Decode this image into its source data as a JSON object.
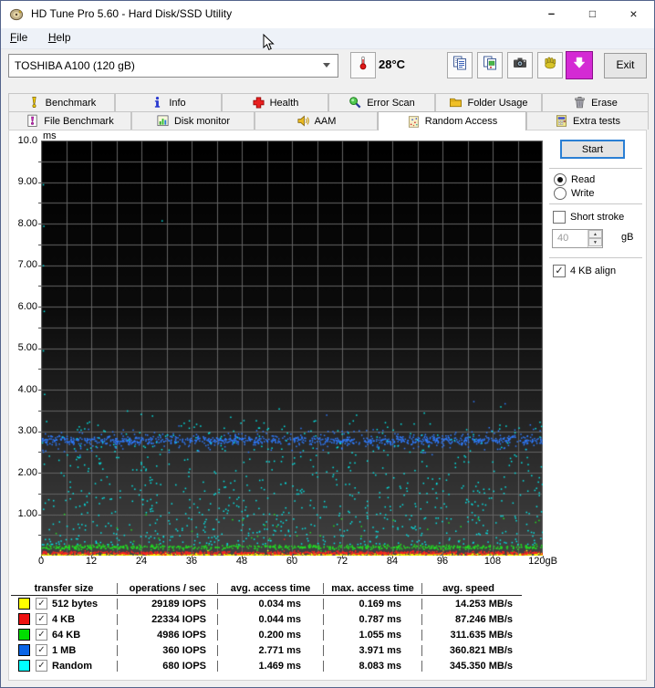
{
  "window": {
    "title": "HD Tune Pro 5.60 - Hard Disk/SSD Utility"
  },
  "icons": {
    "minimize_glyph": "–",
    "maximize_glyph": "□",
    "close_glyph": "×",
    "checkmark_glyph": "✓",
    "spin_up_glyph": "▲",
    "spin_down_glyph": "▼"
  },
  "menu": {
    "items": [
      {
        "label": "File"
      },
      {
        "label": "Help"
      }
    ]
  },
  "toolbar": {
    "drive_selector_value": "TOSHIBA A100 (120 gB)",
    "temperature": "28°C",
    "buttons": [
      {
        "icon": "thermometer-icon"
      },
      {
        "icon": "copy-text-icon"
      },
      {
        "icon": "copy-image-icon"
      },
      {
        "icon": "camera-icon"
      },
      {
        "icon": "donate-hand-icon"
      },
      {
        "icon": "download-icon"
      }
    ],
    "exit_label": "Exit"
  },
  "tabs": {
    "row1": [
      {
        "label": "Benchmark",
        "icon": "benchmark-icon"
      },
      {
        "label": "Info",
        "icon": "info-icon"
      },
      {
        "label": "Health",
        "icon": "health-icon"
      },
      {
        "label": "Error Scan",
        "icon": "error-scan-icon"
      },
      {
        "label": "Folder Usage",
        "icon": "folder-icon"
      },
      {
        "label": "Erase",
        "icon": "erase-icon"
      }
    ],
    "row2": [
      {
        "label": "File Benchmark",
        "icon": "file-benchmark-icon"
      },
      {
        "label": "Disk monitor",
        "icon": "disk-monitor-icon"
      },
      {
        "label": "AAM",
        "icon": "aam-icon"
      },
      {
        "label": "Random Access",
        "icon": "random-access-icon",
        "active": true
      },
      {
        "label": "Extra tests",
        "icon": "extra-tests-icon"
      }
    ],
    "active_tab": "Random Access"
  },
  "side_panel": {
    "start_label": "Start",
    "mode_options": [
      {
        "label": "Read",
        "selected": true
      },
      {
        "label": "Write",
        "selected": false
      }
    ],
    "short_stroke_label": "Short stroke",
    "short_stroke_checked": false,
    "short_stroke_value": "40",
    "short_stroke_unit": "gB",
    "align_label": "4 KB align",
    "align_checked": true
  },
  "chart_data": {
    "type": "scatter",
    "title": "Random Access access-time vs disk position",
    "ylabel_unit": "ms",
    "xlabel_unit": "gB",
    "ylim": [
      0,
      10
    ],
    "xlim": [
      0,
      120
    ],
    "grid": {
      "on": true,
      "x_step": 6,
      "y_step": 0.5
    },
    "y_ticks": [
      {
        "v": 10,
        "label": "10.0"
      },
      {
        "v": 9,
        "label": "9.00"
      },
      {
        "v": 8,
        "label": "8.00"
      },
      {
        "v": 7,
        "label": "7.00"
      },
      {
        "v": 6,
        "label": "6.00"
      },
      {
        "v": 5,
        "label": "5.00"
      },
      {
        "v": 4,
        "label": "4.00"
      },
      {
        "v": 3,
        "label": "3.00"
      },
      {
        "v": 2,
        "label": "2.00"
      },
      {
        "v": 1,
        "label": "1.00"
      }
    ],
    "x_ticks": [
      {
        "v": 0,
        "label": "0"
      },
      {
        "v": 12,
        "label": "12"
      },
      {
        "v": 24,
        "label": "24"
      },
      {
        "v": 36,
        "label": "36"
      },
      {
        "v": 48,
        "label": "48"
      },
      {
        "v": 60,
        "label": "60"
      },
      {
        "v": 72,
        "label": "72"
      },
      {
        "v": 84,
        "label": "84"
      },
      {
        "v": 96,
        "label": "96"
      },
      {
        "v": 108,
        "label": "108"
      },
      {
        "v": 120,
        "label": "120gB"
      }
    ],
    "series": [
      {
        "name": "512 bytes",
        "color": "#ffff00",
        "iops": 29189,
        "avg_access_ms": 0.034,
        "max_access_ms": 0.169,
        "avg_speed_mbs": 14.253,
        "render": {
          "kind": "band",
          "center": 0.03,
          "sigma": 0.02,
          "count": 650,
          "outlier_to": 0.16,
          "outlier_rate": 0.012
        }
      },
      {
        "name": "4 KB",
        "color": "#ff2222",
        "iops": 22334,
        "avg_access_ms": 0.044,
        "max_access_ms": 0.787,
        "avg_speed_mbs": 87.246,
        "render": {
          "kind": "band",
          "center": 0.08,
          "sigma": 0.02,
          "count": 700,
          "outlier_to": 0.5,
          "outlier_rate": 0.005
        }
      },
      {
        "name": "64 KB",
        "color": "#22dd22",
        "iops": 4986,
        "avg_access_ms": 0.2,
        "max_access_ms": 1.055,
        "avg_speed_mbs": 311.635,
        "render": {
          "kind": "band",
          "center": 0.22,
          "sigma": 0.03,
          "count": 680,
          "outlier_to": 1.05,
          "outlier_rate": 0.05
        }
      },
      {
        "name": "1 MB",
        "color": "#2e7bff",
        "iops": 360,
        "avg_access_ms": 2.771,
        "max_access_ms": 3.971,
        "avg_speed_mbs": 360.821,
        "render": {
          "kind": "band",
          "center": 2.79,
          "sigma": 0.05,
          "wide_sigma": 0.13,
          "wide_rate": 0.3,
          "count": 1050,
          "outlier_to": 3.95,
          "outlier_rate": 0.012
        }
      },
      {
        "name": "Random",
        "color": "#00e8e8",
        "iops": 680,
        "avg_access_ms": 1.469,
        "max_access_ms": 8.083,
        "avg_speed_mbs": 345.35,
        "render": {
          "kind": "scatter",
          "min": 0.28,
          "span": 3.0,
          "pow": 1.5,
          "count": 800,
          "outliers": [
            [
              28.8,
              8.08
            ],
            [
              0.4,
              8.95
            ],
            [
              0.5,
              7.95
            ],
            [
              0.4,
              7.0
            ],
            [
              0.6,
              5.9
            ],
            [
              0.4,
              4.95
            ],
            [
              0.7,
              3.9
            ],
            [
              20.5,
              3.5
            ],
            [
              23.8,
              3.42
            ],
            [
              26.5,
              3.38
            ],
            [
              56.8,
              3.55
            ],
            [
              91.5,
              3.45
            ],
            [
              109.8,
              3.6
            ],
            [
              45.2,
              3.35
            ],
            [
              75.3,
              3.4
            ]
          ]
        }
      }
    ]
  },
  "results_table": {
    "headers": [
      "transfer size",
      "operations / sec",
      "avg. access time",
      "max. access time",
      "avg. speed"
    ],
    "rows": [
      {
        "swatch_color": "#ffff00",
        "checked": true,
        "label": "512 bytes",
        "ops": "29189 IOPS",
        "avg": "0.034 ms",
        "max": "0.169 ms",
        "speed": "14.253 MB/s"
      },
      {
        "swatch_color": "#ee1111",
        "checked": true,
        "label": "4 KB",
        "ops": "22334 IOPS",
        "avg": "0.044 ms",
        "max": "0.787 ms",
        "speed": "87.246 MB/s"
      },
      {
        "swatch_color": "#00dd00",
        "checked": true,
        "label": "64 KB",
        "ops": "4986 IOPS",
        "avg": "0.200 ms",
        "max": "1.055 ms",
        "speed": "311.635 MB/s"
      },
      {
        "swatch_color": "#0a64e6",
        "checked": true,
        "label": "1 MB",
        "ops": "360 IOPS",
        "avg": "2.771 ms",
        "max": "3.971 ms",
        "speed": "360.821 MB/s"
      },
      {
        "swatch_color": "#00ffff",
        "checked": true,
        "label": "Random",
        "ops": "680 IOPS",
        "avg": "1.469 ms",
        "max": "8.083 ms",
        "speed": "345.350 MB/s"
      }
    ]
  }
}
